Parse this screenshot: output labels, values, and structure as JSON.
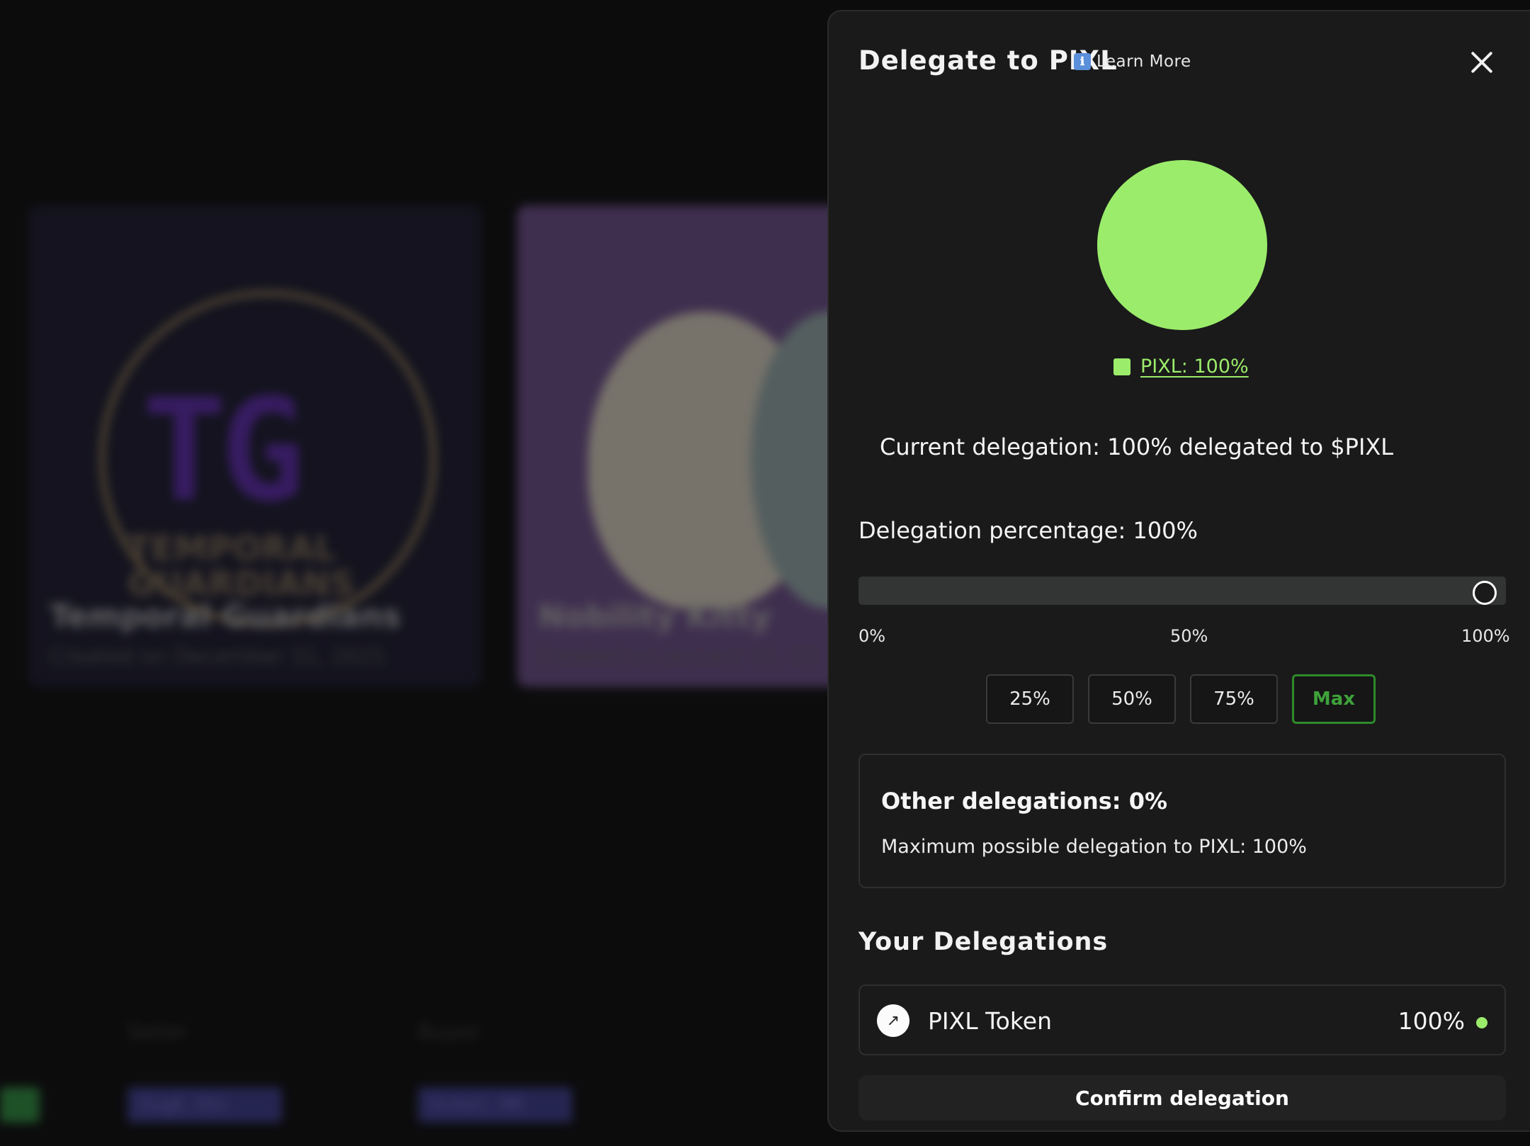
{
  "background": {
    "cards": [
      {
        "title": "Temporal Guardians",
        "subtitle": "TEMPORAL GUARDIANS",
        "logo_text": "TG",
        "date": "Created on December 31, 2025"
      },
      {
        "title": "Nobility Kitty",
        "date": "Created on January 21, 20"
      }
    ],
    "table_headers": [
      "Seller",
      "Buyer"
    ],
    "table_cells": [
      "0xgE..ifm",
      "0x4oC..9R"
    ]
  },
  "modal": {
    "title": "Delegate to PIXL",
    "learn_more": "Learn More",
    "info_icon": "ℹ",
    "close_icon": "close-icon",
    "pie": {
      "slices": [
        {
          "label": "PIXL: 100%",
          "value": 100,
          "color": "#9bec6b"
        }
      ]
    },
    "current_delegation": "Current delegation: 100% delegated to $PIXL",
    "delegation_percentage_label": "Delegation percentage: 100%",
    "slider": {
      "value": 100,
      "min": 0,
      "max": 100,
      "ticks": [
        "0%",
        "50%",
        "100%"
      ]
    },
    "presets": [
      "25%",
      "50%",
      "75%",
      "Max"
    ],
    "active_preset": "Max",
    "other": {
      "title": "Other delegations: 0%",
      "max": "Maximum possible delegation to PIXL: 100%"
    },
    "your_delegations_title": "Your Delegations",
    "delegations": [
      {
        "name": "PIXL Token",
        "percent": "100%",
        "status_color": "#9bec6b",
        "icon": "↗"
      }
    ],
    "confirm_label": "Confirm delegation"
  },
  "colors": {
    "accent": "#9bec6b",
    "max_button": "#2e8b2a",
    "panel_bg": "#1a1a1a"
  }
}
